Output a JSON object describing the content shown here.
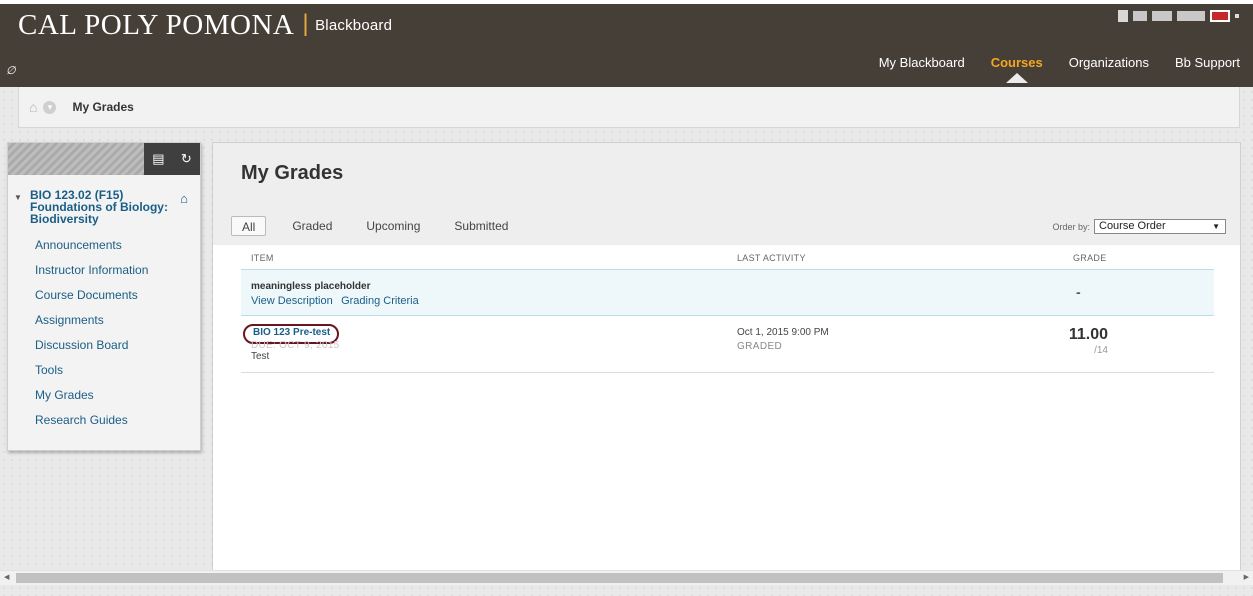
{
  "header": {
    "brand": "CAL POLY POMONA",
    "separator": "|",
    "product": "Blackboard",
    "link_icon": "link-icon",
    "nav": [
      {
        "label": "My Blackboard",
        "active": false
      },
      {
        "label": "Courses",
        "active": true
      },
      {
        "label": "Organizations",
        "active": false
      },
      {
        "label": "Bb Support",
        "active": false
      }
    ],
    "accent_color": "#f5a623",
    "bar_color": "#463f38"
  },
  "breadcrumb": {
    "home_icon": "home-icon",
    "title": "My Grades"
  },
  "course_menu": {
    "course_title": "BIO 123.02 (F15) Foundations of Biology: Biodiversity",
    "items": [
      "Announcements",
      "Instructor Information",
      "Course Documents",
      "Assignments",
      "Discussion Board",
      "Tools",
      "My Grades",
      "Research Guides"
    ],
    "link_color": "#1a5e86"
  },
  "main": {
    "title": "My Grades",
    "filters": [
      "All",
      "Graded",
      "Upcoming",
      "Submitted"
    ],
    "active_filter": "All",
    "order_by_label": "Order by:",
    "order_by_value": "Course Order",
    "columns": [
      "ITEM",
      "LAST ACTIVITY",
      "GRADE"
    ],
    "rows": [
      {
        "title": "meaningless placeholder",
        "links": [
          "View Description",
          "Grading Criteria"
        ],
        "grade": "-"
      },
      {
        "title": "BIO 123 Pre-test",
        "due": "DUE: OCT 9, 2015",
        "type": "Test",
        "last_activity": "Oct 1, 2015 9:00 PM",
        "status": "GRADED",
        "grade": "11.00",
        "max": "/14"
      }
    ],
    "highlight_color": "#6b1420"
  }
}
